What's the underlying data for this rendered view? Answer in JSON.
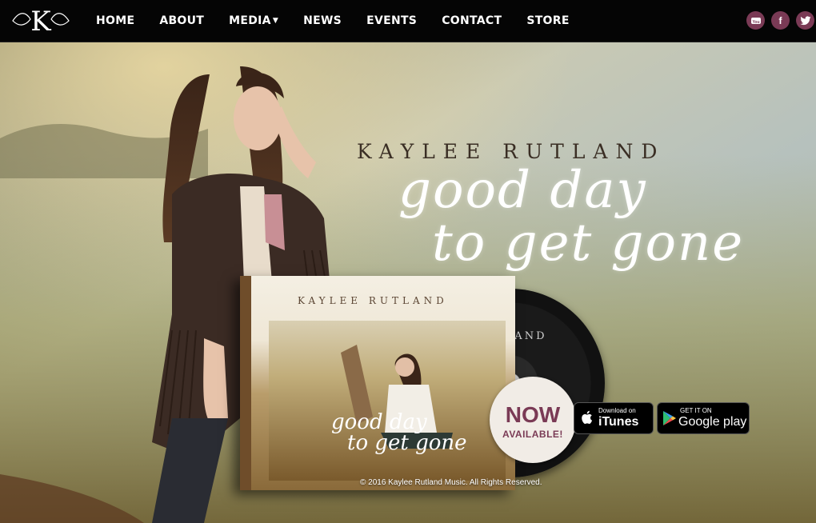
{
  "nav": {
    "logo_text": "K",
    "items": [
      {
        "label": "HOME"
      },
      {
        "label": "ABOUT"
      },
      {
        "label": "MEDIA"
      },
      {
        "label": "NEWS"
      },
      {
        "label": "EVENTS"
      },
      {
        "label": "CONTACT"
      },
      {
        "label": "STORE"
      }
    ],
    "social": [
      {
        "name": "youtube-icon",
        "label": "You"
      },
      {
        "name": "facebook-icon",
        "label": "f"
      },
      {
        "name": "twitter-icon",
        "label": ""
      }
    ]
  },
  "hero": {
    "artist": "KAYLEE RUTLAND",
    "title_line1": "good day",
    "title_line2": "to get gone",
    "album_artist": "KAYLEE RUTLAND",
    "album_title_line1": "good day",
    "album_title_line2": "to get gone",
    "cd_text": "TLAND",
    "now_big": "NOW",
    "now_small": "AVAILABLE!",
    "itunes_small": "Download on",
    "itunes_big": "iTunes",
    "google_small": "GET IT ON",
    "google_big": "Google play",
    "copyright": "© 2016 Kaylee Rutland Music. All Rights Reserved."
  },
  "colors": {
    "accent": "#7a3a55",
    "nav_bg": "#050505"
  }
}
